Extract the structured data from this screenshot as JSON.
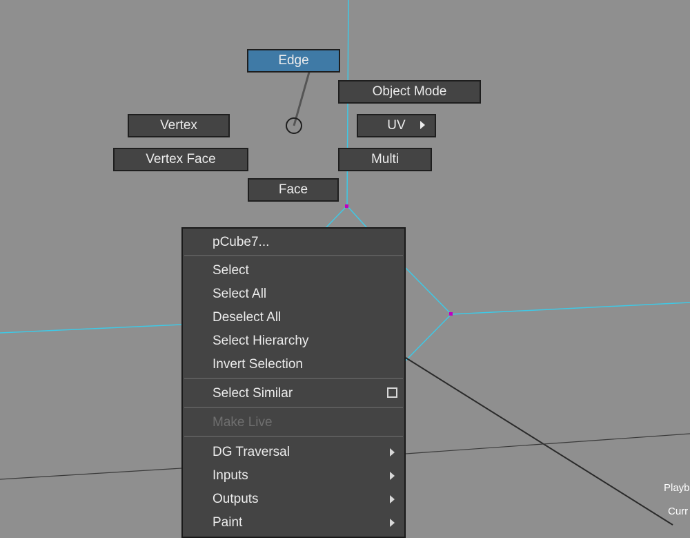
{
  "marking_menu": {
    "edge": "Edge",
    "object_mode": "Object Mode",
    "vertex": "Vertex",
    "uv": "UV",
    "vertex_face": "Vertex Face",
    "multi": "Multi",
    "face": "Face"
  },
  "context_menu": {
    "header": "pCube7...",
    "select": "Select",
    "select_all": "Select All",
    "deselect_all": "Deselect All",
    "select_hierarchy": "Select Hierarchy",
    "invert_selection": "Invert Selection",
    "select_similar": "Select Similar",
    "make_live": "Make Live",
    "dg_traversal": "DG Traversal",
    "inputs": "Inputs",
    "outputs": "Outputs",
    "paint": "Paint"
  },
  "hud": {
    "playback": "Playb",
    "current": "Curr"
  },
  "colors": {
    "viewport_bg": "#8f8f8f",
    "active_item": "#3f7aa6",
    "wireframe_highlight": "#3ec9e6",
    "vertex_marker": "#c000c0"
  }
}
